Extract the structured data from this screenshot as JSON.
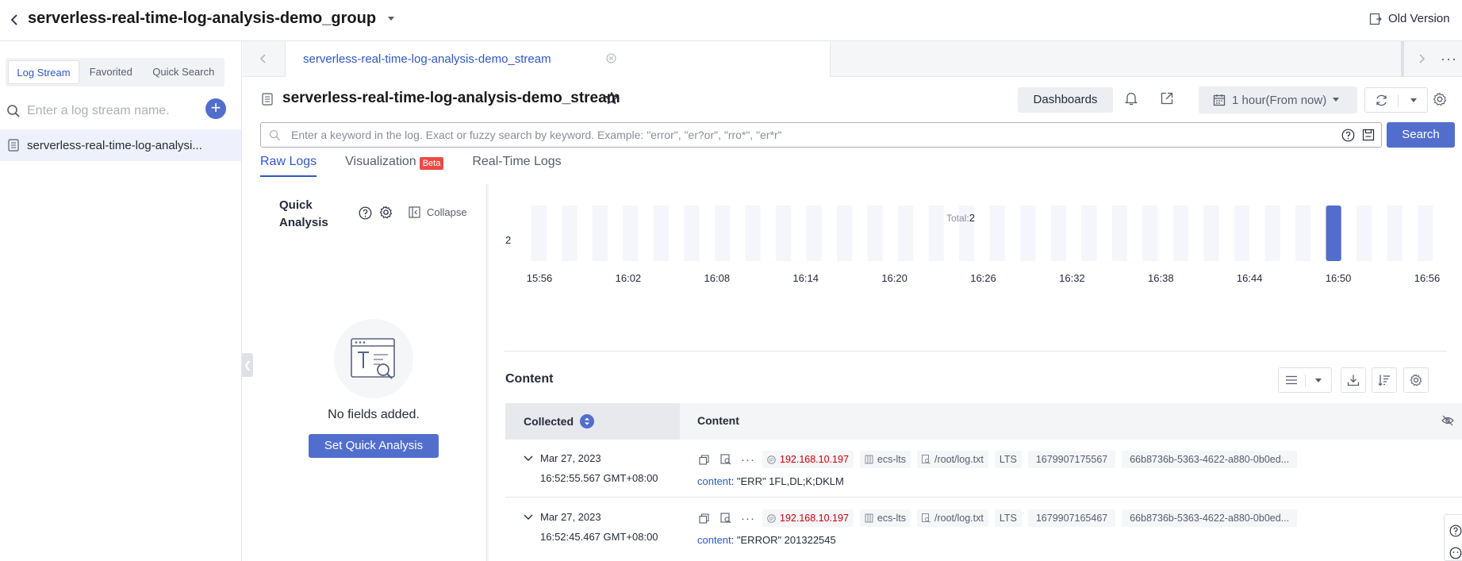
{
  "header": {
    "group_title": "serverless-real-time-log-analysis-demo_group",
    "old_version_label": "Old Version"
  },
  "sidebar": {
    "tabs": [
      {
        "label": "Log Stream",
        "active": true
      },
      {
        "label": "Favorited",
        "active": false
      },
      {
        "label": "Quick Search",
        "active": false
      }
    ],
    "search_placeholder": "Enter a log stream name.",
    "streams": [
      {
        "label": "serverless-real-time-log-analysi..."
      }
    ]
  },
  "tabstrip": {
    "open_tab": "serverless-real-time-log-analysis-demo_stream"
  },
  "stream": {
    "title": "serverless-real-time-log-analysis-demo_stream",
    "dashboards_label": "Dashboards",
    "time_range_label": "1 hour(From now)",
    "search_placeholder": "Enter a keyword in the log. Exact or fuzzy search by keyword. Example: \"error\", \"er?or\", \"rro*\", \"er*r\"",
    "search_button": "Search",
    "view_tabs": [
      {
        "label": "Raw Logs",
        "active": true
      },
      {
        "label": "Visualization",
        "badge": "Beta",
        "active": false
      },
      {
        "label": "Real-Time Logs",
        "active": false
      }
    ]
  },
  "quick_analysis": {
    "title": "Quick Analysis",
    "collapse_label": "Collapse",
    "empty_text": "No fields added.",
    "set_button": "Set Quick Analysis"
  },
  "chart_data": {
    "type": "bar",
    "total_label": "Total:",
    "total_value": "2",
    "ytick": "2",
    "ylim": [
      0,
      2
    ],
    "xticks": [
      "15:56",
      "16:02",
      "16:08",
      "16:14",
      "16:20",
      "16:26",
      "16:32",
      "16:38",
      "16:44",
      "16:50",
      "16:56"
    ],
    "bucket_count": 30,
    "values": [
      0,
      0,
      0,
      0,
      0,
      0,
      0,
      0,
      0,
      0,
      0,
      0,
      0,
      0,
      0,
      0,
      0,
      0,
      0,
      0,
      0,
      0,
      0,
      0,
      0,
      0,
      2,
      0,
      0,
      0
    ],
    "bar_color": "#526ecc",
    "empty_color": "#f5f6fb"
  },
  "content": {
    "section_label": "Content",
    "col_collected": "Collected",
    "col_content": "Content",
    "rows": [
      {
        "date": "Mar 27, 2023",
        "time": "16:52:55.567 GMT+08:00",
        "ip": "192.168.10.197",
        "host": "ecs-lts",
        "path": "/root/log.txt",
        "category": "LTS",
        "timestamp": "1679907175567",
        "id": "66b8736b-5363-4622-a880-0b0ed...",
        "content_key": "content",
        "content_value": "\"ERR\" 1FL,DL;K;DKLM"
      },
      {
        "date": "Mar 27, 2023",
        "time": "16:52:45.467 GMT+08:00",
        "ip": "192.168.10.197",
        "host": "ecs-lts",
        "path": "/root/log.txt",
        "category": "LTS",
        "timestamp": "1679907165467",
        "id": "66b8736b-5363-4622-a880-0b0ed...",
        "content_key": "content",
        "content_value": "\"ERROR\" 201322545"
      }
    ]
  }
}
